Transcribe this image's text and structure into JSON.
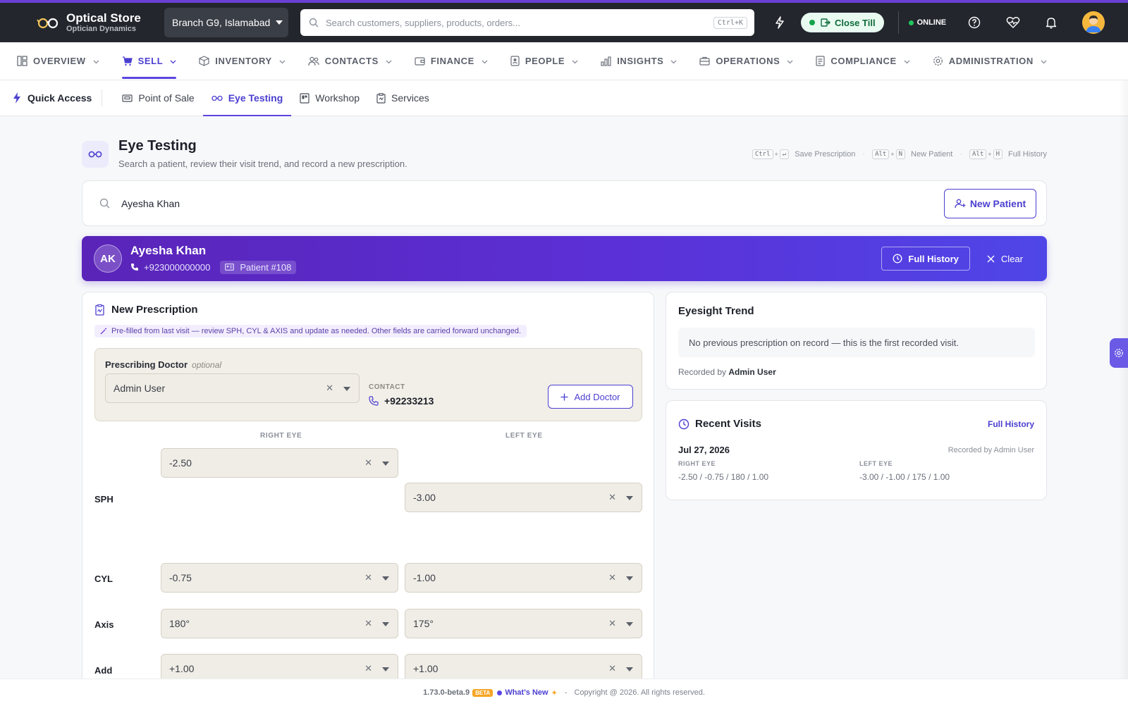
{
  "app": {
    "name": "Optical Store",
    "subtitle": "Optician Dynamics",
    "branch": "Branch G9, Islamabad",
    "search_placeholder": "Search customers, suppliers, products, orders...",
    "search_shortcut": "Ctrl+K",
    "close_till": "Close Till",
    "status": "ONLINE",
    "accent": "#5a45e0",
    "topbar_bg": "#23262d"
  },
  "nav": [
    {
      "label": "OVERVIEW",
      "icon": "dashboard-icon"
    },
    {
      "label": "SELL",
      "icon": "cart-icon",
      "active": true
    },
    {
      "label": "INVENTORY",
      "icon": "box-icon"
    },
    {
      "label": "CONTACTS",
      "icon": "users-icon"
    },
    {
      "label": "FINANCE",
      "icon": "wallet-icon"
    },
    {
      "label": "PEOPLE",
      "icon": "badge-icon"
    },
    {
      "label": "INSIGHTS",
      "icon": "bar-chart-icon"
    },
    {
      "label": "OPERATIONS",
      "icon": "briefcase-icon"
    },
    {
      "label": "COMPLIANCE",
      "icon": "document-icon"
    },
    {
      "label": "ADMINISTRATION",
      "icon": "gear-icon"
    }
  ],
  "subnav": {
    "quick_access": "Quick Access",
    "items": [
      {
        "label": "Point of Sale",
        "icon": "register-icon"
      },
      {
        "label": "Eye Testing",
        "icon": "glasses-icon",
        "active": true
      },
      {
        "label": "Workshop",
        "icon": "workshop-icon"
      },
      {
        "label": "Services",
        "icon": "clipboard-icon"
      }
    ]
  },
  "page": {
    "title": "Eye Testing",
    "subtitle": "Search a patient, review their visit trend, and record a new prescription.",
    "shortcuts": [
      {
        "keys": [
          "Ctrl",
          "↵"
        ],
        "label": "Save Prescription"
      },
      {
        "keys": [
          "Alt",
          "N"
        ],
        "label": "New Patient"
      },
      {
        "keys": [
          "Alt",
          "H"
        ],
        "label": "Full History"
      }
    ]
  },
  "search": {
    "value": "Ayesha Khan",
    "new_patient": "New Patient"
  },
  "patient": {
    "initials": "AK",
    "name": "Ayesha Khan",
    "phone": "+923000000000",
    "id": "Patient #108",
    "full_history": "Full History",
    "clear": "Clear"
  },
  "prescription": {
    "title": "New Prescription",
    "note": "Pre-filled from last visit — review SPH, CYL & AXIS and update as needed. Other fields are carried forward unchanged.",
    "doctor_label": "Prescribing Doctor",
    "doctor_optional": "optional",
    "doctor_value": "Admin User",
    "contact_label": "CONTACT",
    "contact_value": "+92233213",
    "add_doctor": "Add Doctor",
    "right_eye_label": "RIGHT EYE",
    "left_eye_label": "LEFT EYE",
    "rows": {
      "sph": {
        "label": "SPH",
        "right": "-2.50",
        "left": "-3.00"
      },
      "cyl": {
        "label": "CYL",
        "right": "-0.75",
        "left": "-1.00"
      },
      "axis": {
        "label": "Axis",
        "right": "180°",
        "left": "175°"
      },
      "add": {
        "label": "Add",
        "right": "+1.00",
        "left": "+1.00"
      }
    }
  },
  "trend": {
    "title": "Eyesight Trend",
    "empty": "No previous prescription on record — this is the first recorded visit.",
    "recorded_prefix": "Recorded by",
    "recorded_by": "Admin User"
  },
  "visits": {
    "title": "Recent Visits",
    "link": "Full History",
    "items": [
      {
        "date": "Jul 27, 2026",
        "recorded_by": "Recorded by Admin User",
        "right_label": "RIGHT EYE",
        "right": "-2.50 / -0.75 / 180 / 1.00",
        "left_label": "LEFT EYE",
        "left": "-3.00 / -1.00 / 175 / 1.00"
      }
    ]
  },
  "footer": {
    "version": "1.73.0-beta.9",
    "beta": "BETA",
    "whats_new": "What's New",
    "separator": "-",
    "copyright": "Copyright @ 2026. All rights reserved."
  }
}
